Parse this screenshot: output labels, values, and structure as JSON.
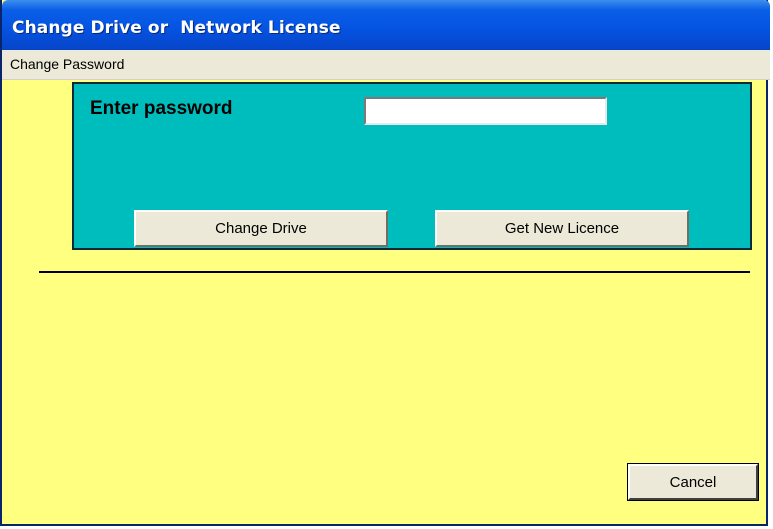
{
  "window": {
    "title": "Change Drive or  Network License"
  },
  "menu": {
    "items": [
      "Change Password"
    ]
  },
  "form": {
    "password_label": "Enter password",
    "password_value": "",
    "change_drive_label": "Change Drive",
    "get_new_licence_label": "Get New Licence",
    "cancel_label": "Cancel"
  },
  "colors": {
    "title_bar": "#0554e3",
    "window_background": "#ffff80",
    "panel_background": "#00bdbd",
    "button_face": "#ece9d8"
  }
}
